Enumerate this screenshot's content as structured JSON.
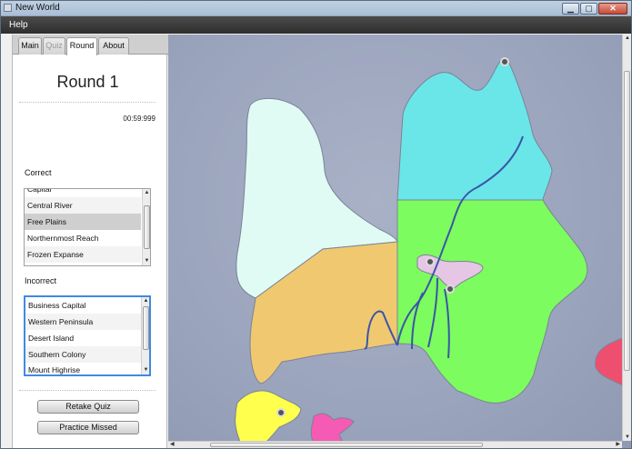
{
  "window": {
    "title": "New World",
    "min_icon": "minimize-icon",
    "max_icon": "maximize-icon",
    "close_icon": "close-icon"
  },
  "menu": {
    "help": "Help"
  },
  "tabs": {
    "main": "Main",
    "quiz": "Quiz",
    "round": "Round",
    "about": "About"
  },
  "round": {
    "title": "Round 1",
    "timer": "00:59:999"
  },
  "correct": {
    "label": "Correct",
    "items": [
      "Capital",
      "Central River",
      "Free Plains",
      "Northernmost Reach",
      "Frozen Expanse"
    ],
    "selected": "Free Plains"
  },
  "incorrect": {
    "label": "Incorrect",
    "items": [
      "Business Capital",
      "Western Peninsula",
      "Desert Island",
      "Southern Colony",
      "Mount Highrise"
    ]
  },
  "buttons": {
    "retake": "Retake Quiz",
    "practice": "Practice Missed"
  },
  "map_colors": {
    "frozen_expanse": "#e0fbf4",
    "northernmost_reach": "#6ae6e8",
    "free_plains": "#7cfc5e",
    "desert": "#f0c870",
    "capital_region": "#e6c6e4",
    "island_yellow": "#ffff4e",
    "colony_pink": "#f55ab4",
    "east_red": "#ef4f6e",
    "river": "#3b55a8"
  }
}
